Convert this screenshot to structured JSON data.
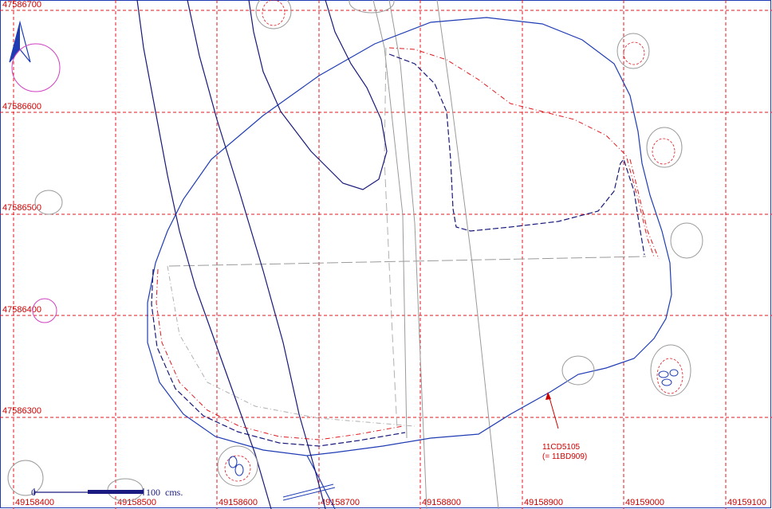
{
  "grid": {
    "color": "#e0191f",
    "x_labels": [
      "49158400",
      "49158500",
      "49158600",
      "49158700",
      "49158800",
      "49158900",
      "49159000",
      "49159100"
    ],
    "y_labels": [
      "47586700",
      "47586600",
      "47586500",
      "47586400",
      "47586300"
    ]
  },
  "scale_bar": {
    "start_label": "0",
    "end_label": "100",
    "unit": "cms."
  },
  "annotation": {
    "line1": "11CD5105",
    "line2": "(= 11BD909)"
  },
  "north_arrow": {
    "icon": "north-arrow-icon"
  },
  "colors": {
    "contour_blue": "#1f3cb4",
    "contour_dark": "#18187a",
    "gray_line": "#9a9a9a",
    "red_dash": "#e0191f",
    "magenta": "#d040c0"
  }
}
